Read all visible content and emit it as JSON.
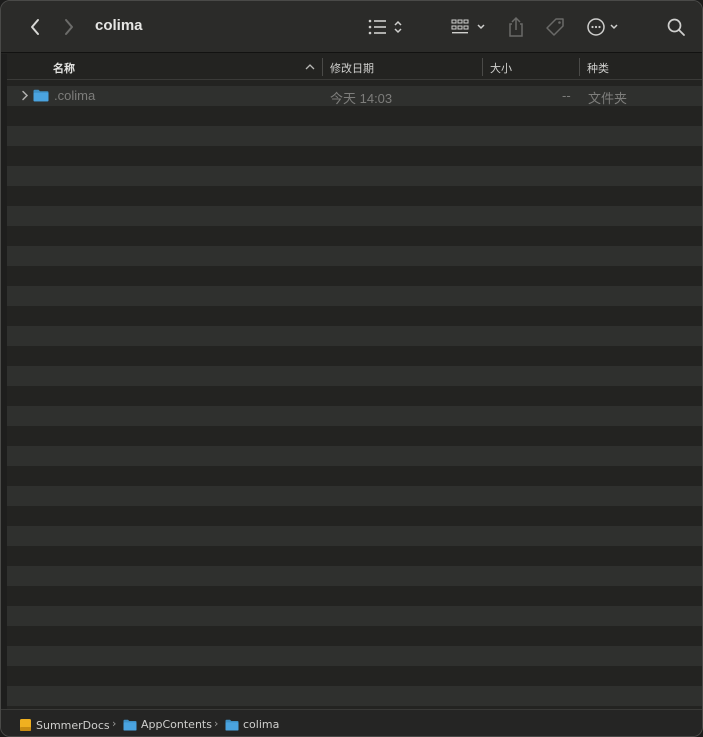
{
  "window": {
    "title": "colima"
  },
  "toolbar": {
    "back": "chevron-left-icon",
    "forward": "chevron-right-icon",
    "view_list": "list-view-icon",
    "view_grid": "grid-view-icon",
    "share": "share-icon",
    "tag": "tag-icon",
    "more": "ellipsis-circle-icon",
    "search": "search-icon"
  },
  "columns": {
    "name": "名称",
    "modified": "修改日期",
    "size": "大小",
    "kind": "种类"
  },
  "files": [
    {
      "name": ".colima",
      "modified": "今天 14:03",
      "size": "--",
      "kind": "文件夹"
    }
  ],
  "pathbar": {
    "crumbs": [
      {
        "label": "SummerDocs",
        "icon": "drive-icon"
      },
      {
        "label": "AppContents",
        "icon": "folder-icon"
      },
      {
        "label": "colima",
        "icon": "folder-icon"
      }
    ]
  },
  "colors": {
    "folder": "#4aa3df",
    "drive": "#f0b020",
    "background": "#232321",
    "stripe": "#2f302e"
  }
}
